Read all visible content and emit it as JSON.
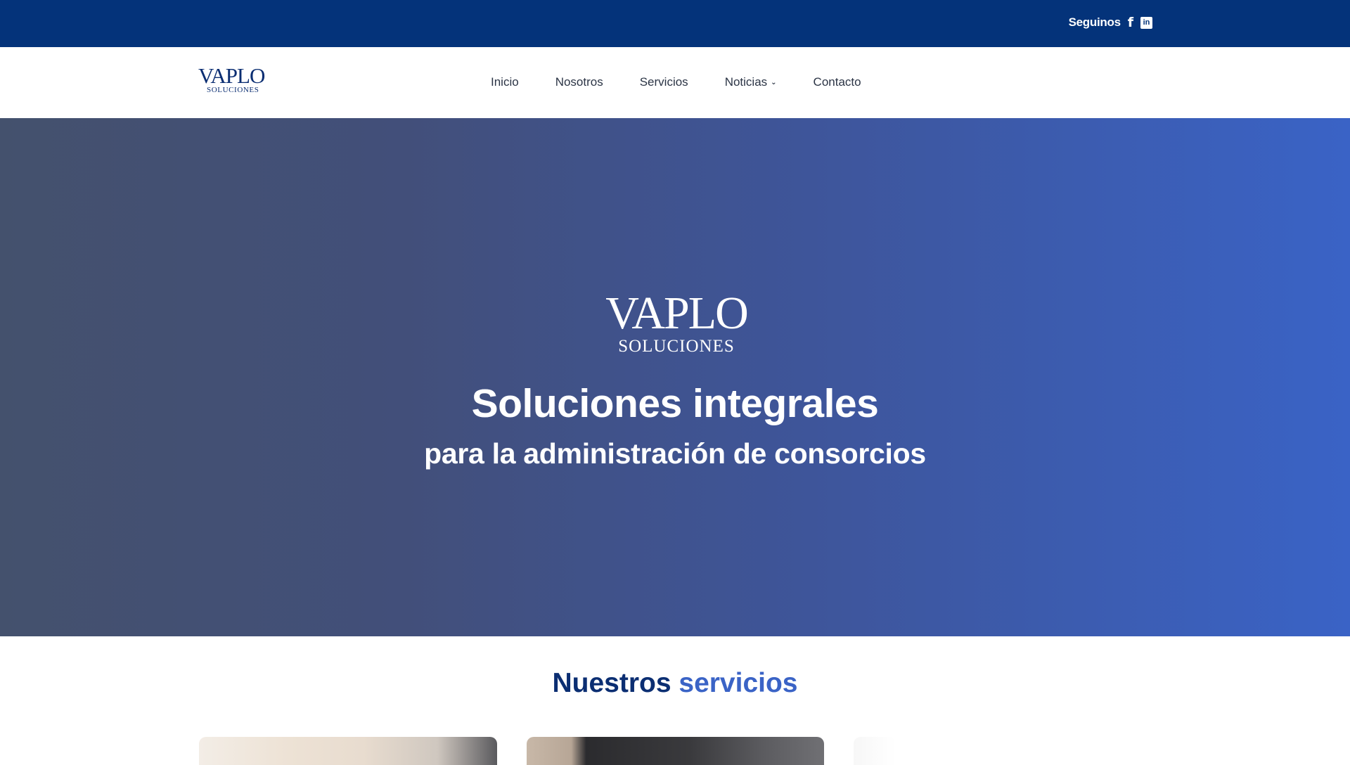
{
  "topbar": {
    "follow_label": "Seguinos",
    "social": [
      {
        "icon": "facebook-icon",
        "glyph": "f"
      },
      {
        "icon": "linkedin-icon",
        "glyph": "in"
      }
    ]
  },
  "header": {
    "logo": {
      "word": "VAPLO",
      "sub": "SOLUCIONES"
    },
    "nav": [
      {
        "label": "Inicio"
      },
      {
        "label": "Nosotros"
      },
      {
        "label": "Servicios"
      },
      {
        "label": "Noticias",
        "has_dropdown": true
      },
      {
        "label": "Contacto"
      }
    ]
  },
  "hero": {
    "logo": {
      "word": "VAPLO",
      "sub": "SOLUCIONES"
    },
    "title": "Soluciones integrales",
    "subtitle": "para la administración de consorcios"
  },
  "services": {
    "heading_part1": "Nuestros",
    "heading_part2": "servicios"
  },
  "colors": {
    "topbar_bg": "#04337a",
    "brand_dark": "#0b2e72",
    "brand_accent": "#3a63c6"
  }
}
